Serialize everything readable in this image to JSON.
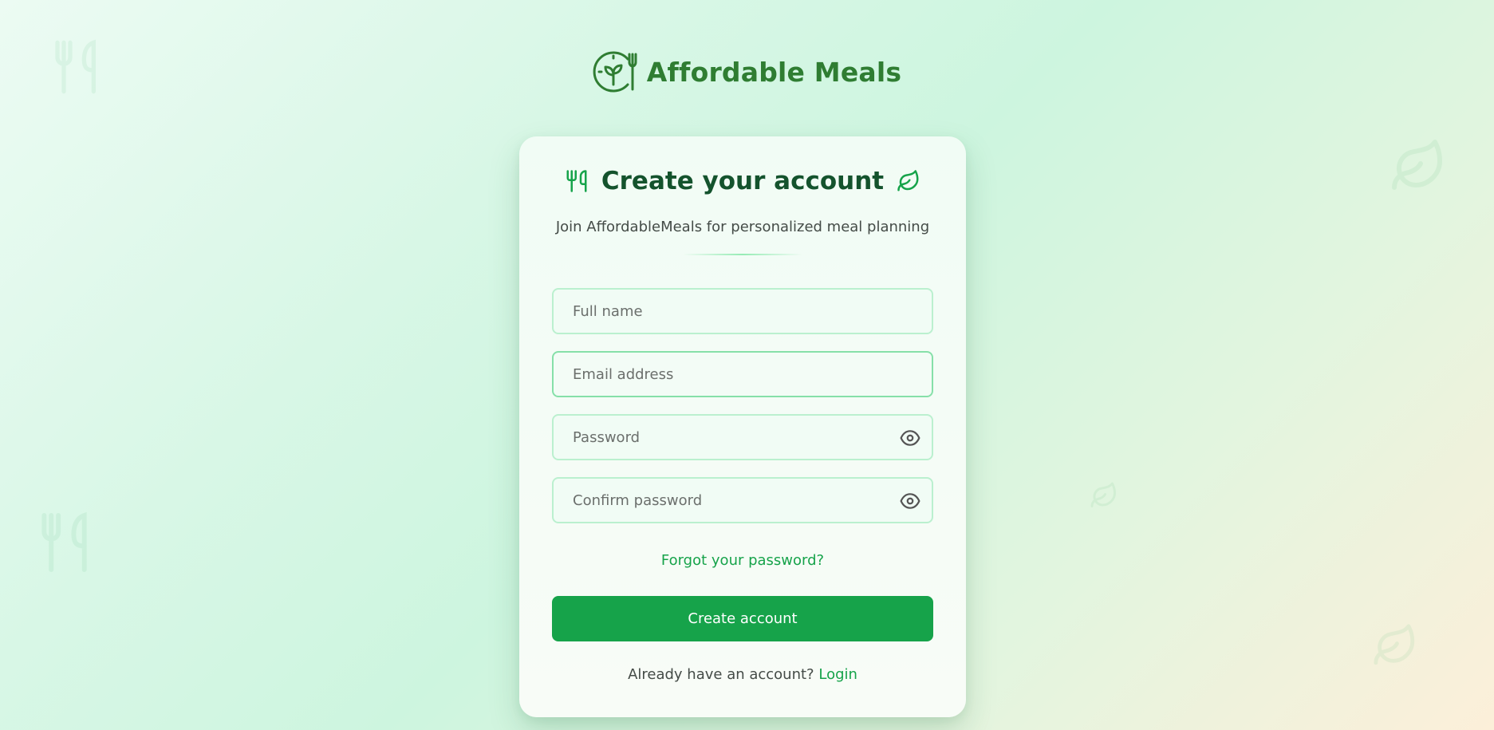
{
  "brand": {
    "name": "Affordable Meals",
    "logo_icon": "plant-clock-utensil-logo",
    "color": "#2f7d32"
  },
  "card": {
    "title": "Create your account",
    "title_left_icon": "utensils-icon",
    "title_right_icon": "leaf-icon",
    "subtitle": "Join AffordableMeals for personalized meal planning"
  },
  "form": {
    "full_name": {
      "placeholder": "Full name",
      "value": ""
    },
    "email": {
      "placeholder": "Email address",
      "value": ""
    },
    "password": {
      "placeholder": "Password",
      "value": "",
      "toggle_icon": "eye-icon"
    },
    "confirm_password": {
      "placeholder": "Confirm password",
      "value": "",
      "toggle_icon": "eye-icon"
    },
    "forgot_link": "Forgot your password?",
    "submit_label": "Create account"
  },
  "footer": {
    "prompt": "Already have an account?",
    "login_link": "Login"
  },
  "colors": {
    "accent": "#16a34a",
    "heading": "#14532d",
    "field_border": "#bbf0cf"
  }
}
